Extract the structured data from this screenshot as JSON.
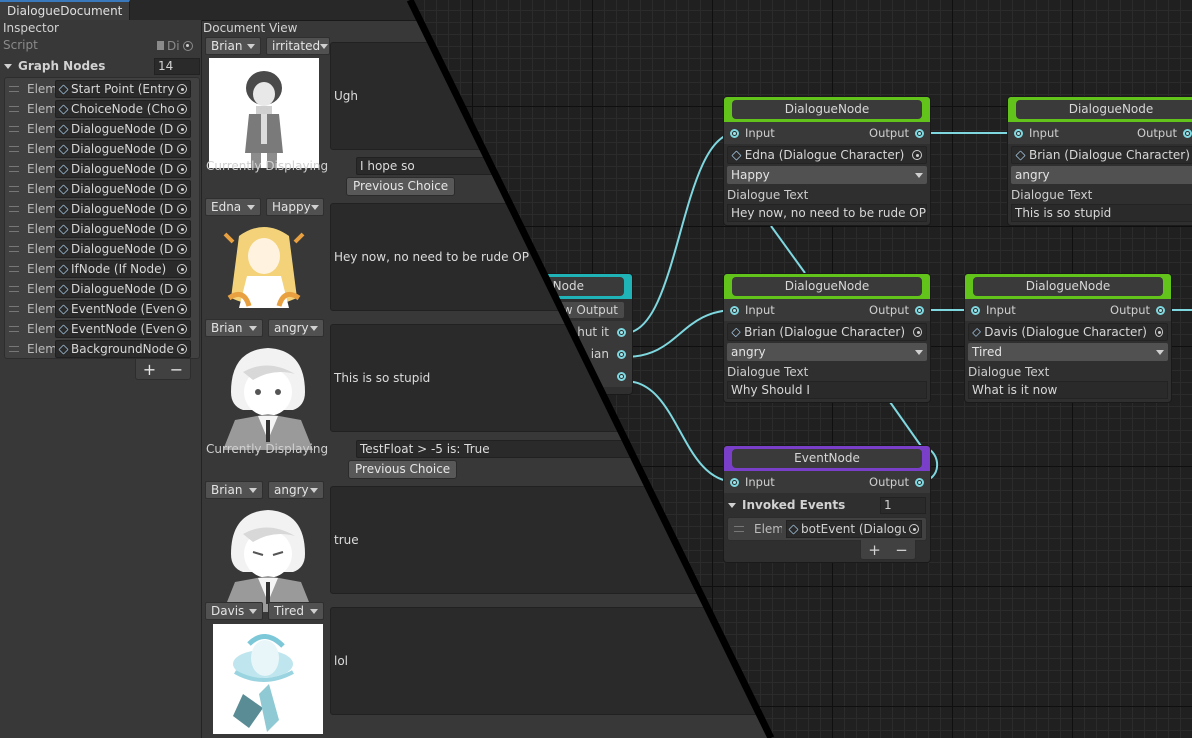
{
  "window": {
    "tab_title": "DialogueDocument"
  },
  "inspector": {
    "title": "Inspector",
    "script_label": "Script",
    "script_value": "Di",
    "graph_nodes_label": "Graph Nodes",
    "graph_nodes_count": "14",
    "element_label": "Elem",
    "elements": [
      "Start Point (Entry I",
      "ChoiceNode (Cho",
      "DialogueNode (Di",
      "DialogueNode (Di",
      "DialogueNode (Di",
      "DialogueNode (Di",
      "DialogueNode (Di",
      "DialogueNode (Di",
      "DialogueNode (Di",
      "IfNode (If Node)",
      "DialogueNode (Di",
      "EventNode (Event",
      "EventNode (Event",
      "BackgroundNode"
    ],
    "add_label": "+",
    "remove_label": "−"
  },
  "document_view": {
    "title": "Document View",
    "currently_displaying_label": "Currently Displaying",
    "previous_choice_label": "Previous Choice",
    "entries": [
      {
        "character": "Brian",
        "mood": "irritated",
        "text": "Ugh"
      },
      {
        "character": "Edna",
        "mood": "Happy",
        "text": "Hey now, no need to be rude OP"
      },
      {
        "character": "Brian",
        "mood": "angry",
        "text": "This is so stupid"
      },
      {
        "character": "Brian",
        "mood": "angry",
        "text": "true"
      },
      {
        "character": "Davis",
        "mood": "Tired",
        "text": "lol"
      }
    ],
    "choices": [
      {
        "value": "I hope so"
      },
      {
        "value": "TestFloat > -5 is: True"
      }
    ]
  },
  "graph": {
    "partial_node": {
      "title": "eNode",
      "output_label": "w Output",
      "rows": [
        "hut it",
        "ian",
        ""
      ]
    },
    "nodes": [
      {
        "id": "edna",
        "title": "DialogueNode",
        "input": "Input",
        "output": "Output",
        "character": "Edna (Dialogue Character)",
        "mood": "Happy",
        "text_label": "Dialogue Text",
        "text": "Hey now, no need to be rude OP"
      },
      {
        "id": "brian-top",
        "title": "DialogueNode",
        "input": "Input",
        "output": "Output",
        "character": "Brian (Dialogue Character)",
        "mood": "angry",
        "text_label": "Dialogue Text",
        "text": "This is so stupid"
      },
      {
        "id": "brian-mid",
        "title": "DialogueNode",
        "input": "Input",
        "output": "Output",
        "character": "Brian (Dialogue Character)",
        "mood": "angry",
        "text_label": "Dialogue Text",
        "text": "Why Should I"
      },
      {
        "id": "davis",
        "title": "DialogueNode",
        "input": "Input",
        "output": "Output",
        "character": "Davis (Dialogue Character)",
        "mood": "Tired",
        "text_label": "Dialogue Text",
        "text": "What is it now"
      }
    ],
    "event_node": {
      "title": "EventNode",
      "input": "Input",
      "output": "Output",
      "invoked_label": "Invoked Events",
      "invoked_count": "1",
      "element_label": "Elem",
      "element_value": "botEvent (Dialogue",
      "add_label": "+",
      "remove_label": "−"
    }
  },
  "colors": {
    "dialogue_header": "#62c41b",
    "event_header": "#7a3fc8",
    "choice_header": "#1fb3b8",
    "edge": "#7fd8e0"
  }
}
